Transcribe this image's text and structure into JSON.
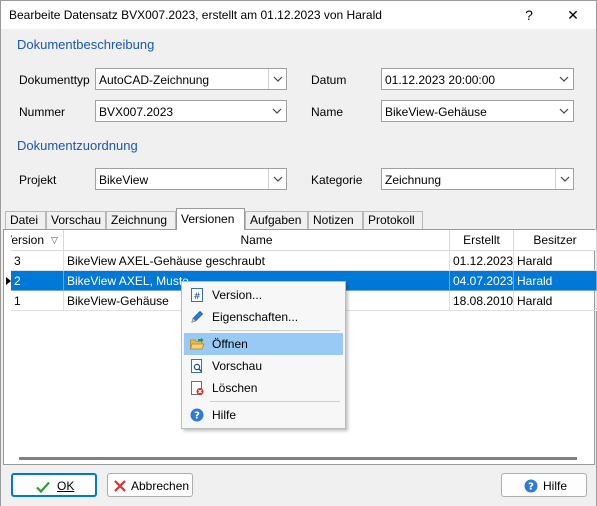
{
  "window": {
    "title": "Bearbeite Datensatz BVX007.2023, erstellt am 01.12.2023 von Harald",
    "help_glyph": "?",
    "close_glyph": "✕"
  },
  "beschreibung": {
    "heading": "Dokumentbeschreibung",
    "dokumenttyp_label": "Dokumenttyp",
    "dokumenttyp_value": "AutoCAD-Zeichnung",
    "datum_label": "Datum",
    "datum_value": "01.12.2023 20:00:00",
    "nummer_label": "Nummer",
    "nummer_value": "BVX007.2023",
    "name_label": "Name",
    "name_value": "BikeView-Gehäuse"
  },
  "zuordnung": {
    "heading": "Dokumentzuordnung",
    "projekt_label": "Projekt",
    "projekt_value": "BikeView",
    "kategorie_label": "Kategorie",
    "kategorie_value": "Zeichnung"
  },
  "tabs": [
    {
      "label": "Datei"
    },
    {
      "label": "Vorschau"
    },
    {
      "label": "Zeichnung"
    },
    {
      "label": "Versionen"
    },
    {
      "label": "Aufgaben"
    },
    {
      "label": "Notizen"
    },
    {
      "label": "Protokoll"
    }
  ],
  "active_tab": "Versionen",
  "grid": {
    "columns": [
      "Version",
      "Name",
      "Erstellt",
      "Besitzer"
    ],
    "rows": [
      {
        "version": "3",
        "name": "BikeView AXEL-Gehäuse geschraubt",
        "erstellt": "01.12.2023",
        "besitzer": "Harald",
        "selected": false
      },
      {
        "version": "2",
        "name": "BikeView AXEL, Muste",
        "erstellt": "04.07.2023",
        "besitzer": "Harald",
        "selected": true
      },
      {
        "version": "1",
        "name": "BikeView-Gehäuse",
        "erstellt": "18.08.2010",
        "besitzer": "Harald",
        "selected": false
      }
    ]
  },
  "context_menu": {
    "items": [
      {
        "label": "Version...",
        "icon": "hash-document-icon"
      },
      {
        "label": "Eigenschaften...",
        "icon": "pencil-icon"
      },
      {
        "label": "Öffnen",
        "icon": "open-folder-icon",
        "highlighted": true
      },
      {
        "label": "Vorschau",
        "icon": "preview-icon"
      },
      {
        "label": "Löschen",
        "icon": "delete-document-icon"
      },
      {
        "label": "Hilfe",
        "icon": "help-icon"
      }
    ]
  },
  "buttons": {
    "ok": "OK",
    "abbrechen": "Abbrechen",
    "hilfe": "Hilfe"
  },
  "colors": {
    "section_heading": "#1a56b4",
    "selection": "#0078d7",
    "menu_highlight": "#99c9f5"
  }
}
